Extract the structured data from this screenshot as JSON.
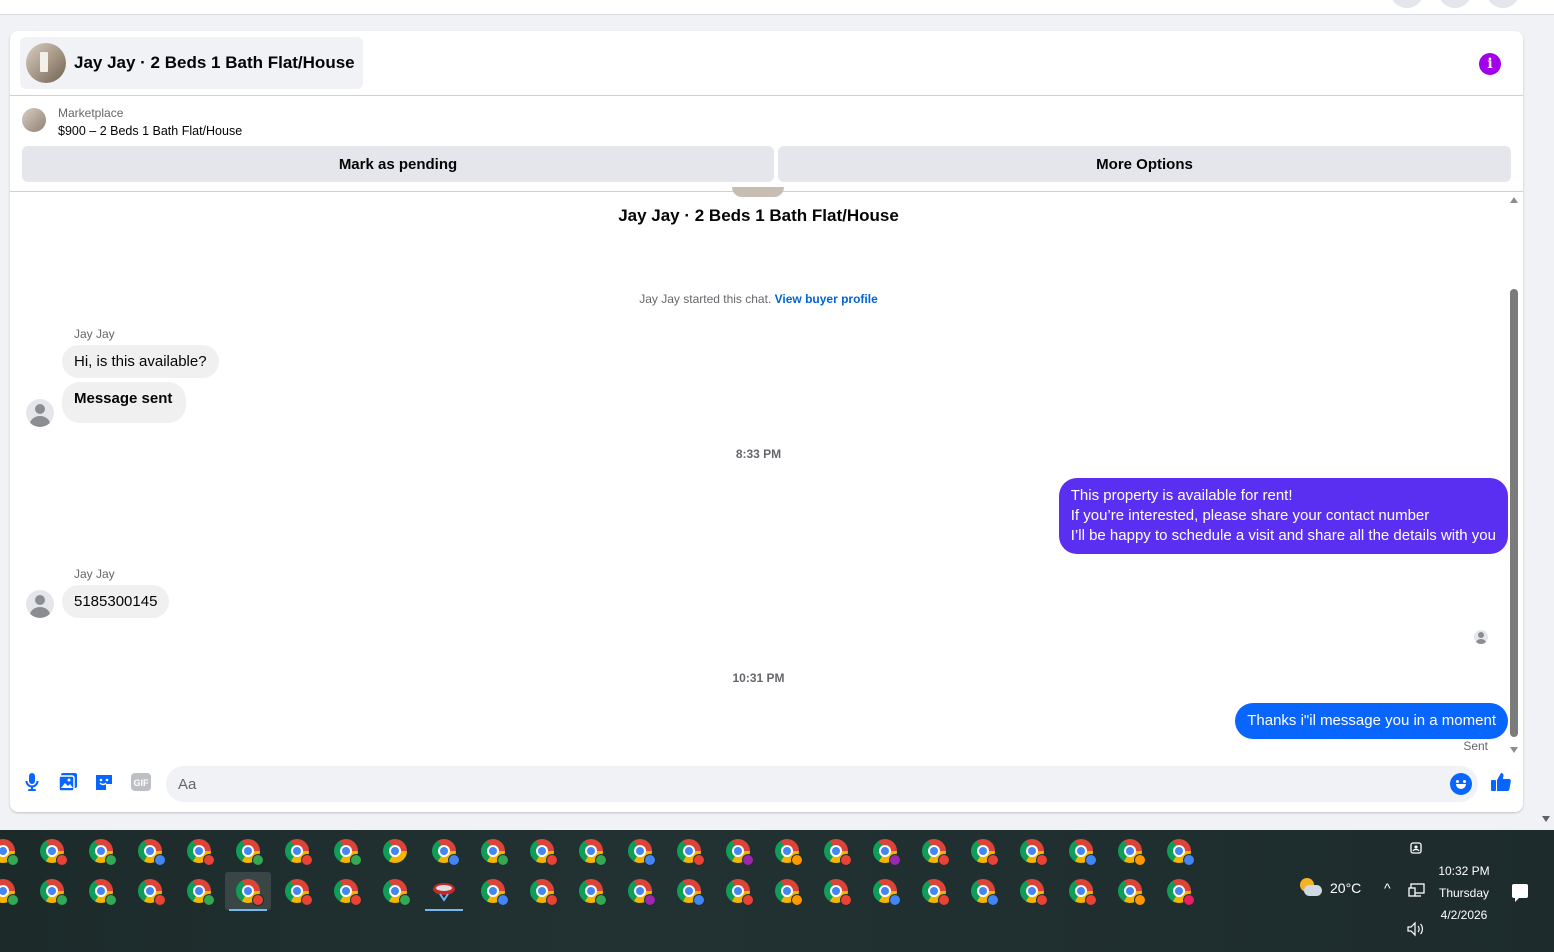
{
  "chat": {
    "header_title": "Jay Jay · 2 Beds 1 Bath Flat/House",
    "listing_source": "Marketplace",
    "listing_price_title": "$900 – 2 Beds 1 Bath Flat/House",
    "mark_pending_label": "Mark as pending",
    "more_options_label": "More Options",
    "info_icon_glyph": "i",
    "conversation_title": "Jay Jay · 2 Beds 1 Bath Flat/House",
    "started_text": "Jay Jay started this chat.",
    "view_profile_label": "View buyer profile",
    "messages": [
      {
        "sender": "Jay Jay",
        "text": "Hi, is this available?"
      },
      {
        "text": "Message sent"
      },
      {
        "timestamp": "8:33 PM"
      },
      {
        "lines": [
          "This property is available for rent!",
          "If you’re interested, please share your contact number",
          "I’ll be happy to schedule a visit and share all the details with you"
        ],
        "color": "#5b2ff1"
      },
      {
        "sender": "Jay Jay",
        "text": "5185300145"
      },
      {
        "timestamp": "10:31 PM"
      },
      {
        "text": "Thanks i\"il message you in a moment",
        "color": "#0866ff",
        "status": "Sent"
      }
    ],
    "composer_placeholder": "Aa",
    "composer_icons": [
      "microphone-icon",
      "photo-icon",
      "sticker-icon",
      "gif-icon",
      "emoji-icon",
      "like-thumb-icon"
    ],
    "gif_label": "GIF"
  },
  "colors": {
    "accent_blue": "#0866ff",
    "accent_purple": "#5b2ff1",
    "info_purple": "#a200e8"
  },
  "taskbar": {
    "row1_icons": [
      "chrome-green",
      "chrome-red",
      "chrome-green",
      "chrome-blue",
      "chrome-red",
      "chrome-green",
      "chrome-red",
      "chrome-green",
      "chrome",
      "chrome-blue",
      "chrome-green",
      "chrome-red",
      "chrome-green",
      "chrome-blue",
      "chrome-red",
      "chrome-purple",
      "chrome-orange",
      "chrome-red",
      "chrome-purple",
      "chrome-red",
      "chrome-red",
      "chrome-red",
      "chrome-blue",
      "chrome-orange",
      "chrome-blue"
    ],
    "row2_icons": [
      "chrome-green",
      "chrome-green",
      "chrome-green",
      "chrome-red",
      "chrome-green",
      "chrome-red",
      "chrome-red",
      "chrome-red",
      "chrome-green",
      "snipping-tool",
      "chrome-blue",
      "chrome-red",
      "chrome-green",
      "chrome-purple",
      "chrome-blue",
      "chrome-red",
      "chrome-orange",
      "chrome-red",
      "chrome-blue",
      "chrome-red",
      "chrome-blue",
      "chrome-red",
      "chrome-red",
      "chrome-orange",
      "chrome-pink"
    ],
    "temperature": "20°C",
    "weather_icon": "partly-sunny-icon",
    "time": "10:32 PM",
    "day": "Thursday",
    "date": "4/2/2026",
    "tray_chevron": "^",
    "tray_icons": [
      "meet-now-icon",
      "network-icon",
      "volume-icon",
      "notification-icon"
    ]
  }
}
